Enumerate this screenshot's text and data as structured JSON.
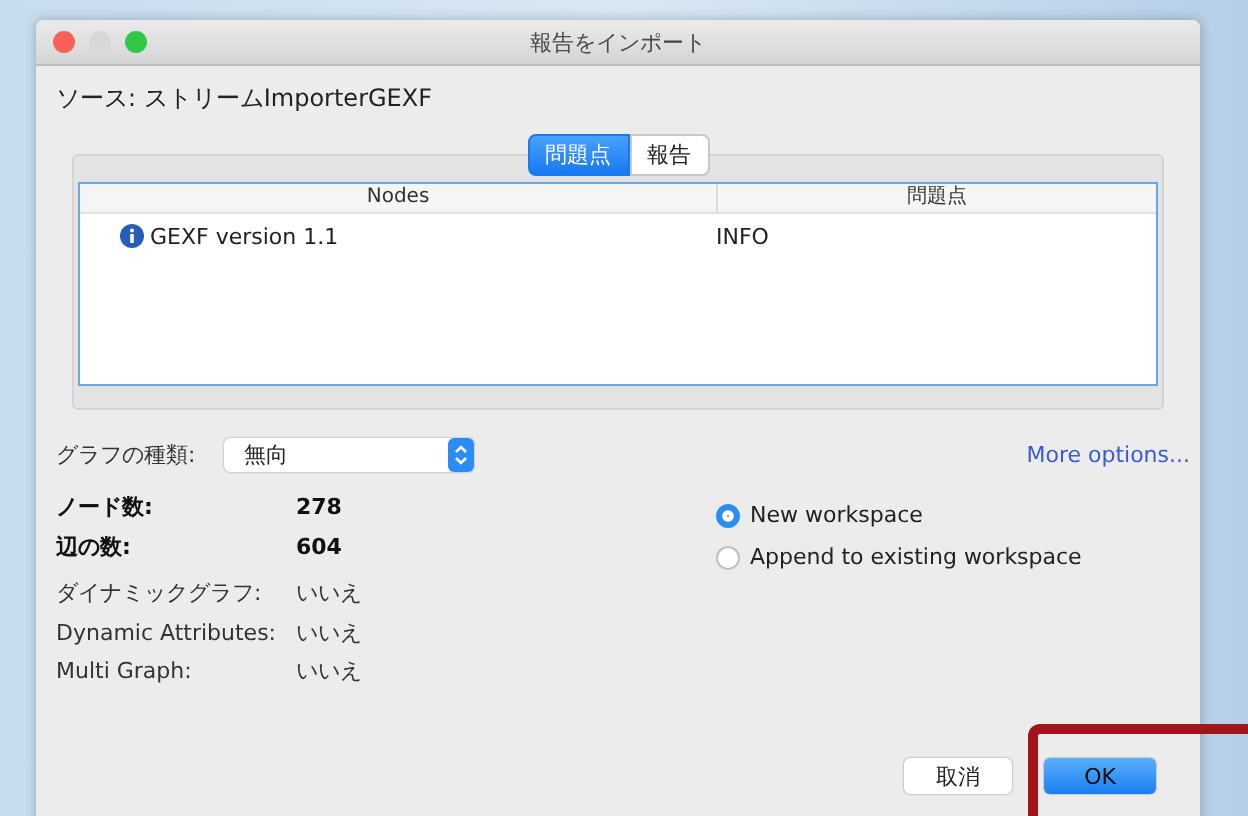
{
  "window": {
    "title": "報告をインポート"
  },
  "source": "ソース: ストリームImporterGEXF",
  "tabs": [
    {
      "label": "問題点",
      "selected": true
    },
    {
      "label": "報告",
      "selected": false
    }
  ],
  "table": {
    "columns": [
      "Nodes",
      "問題点"
    ],
    "rows": [
      {
        "kind": "info",
        "cells": [
          "GEXF version 1.1",
          "INFO"
        ]
      }
    ]
  },
  "graph_type": {
    "label": "グラフの種類:",
    "value": "無向"
  },
  "more_options": "More options...",
  "stats": [
    {
      "kind": "count",
      "label": "ノード数:",
      "value": "278"
    },
    {
      "kind": "count",
      "label": "辺の数:",
      "value": "604"
    },
    {
      "kind": "flag",
      "label": "ダイナミックグラフ:",
      "value": "いいえ"
    },
    {
      "kind": "flag",
      "label": "Dynamic Attributes:",
      "value": "いいえ"
    },
    {
      "kind": "flag",
      "label": "Multi Graph:",
      "value": "いいえ"
    }
  ],
  "workspace_options": [
    {
      "label": "New workspace",
      "selected": true
    },
    {
      "label": "Append to existing workspace",
      "selected": false
    }
  ],
  "buttons": [
    {
      "kind": "cancel",
      "label": "取消"
    },
    {
      "kind": "default",
      "label": "OK"
    }
  ]
}
